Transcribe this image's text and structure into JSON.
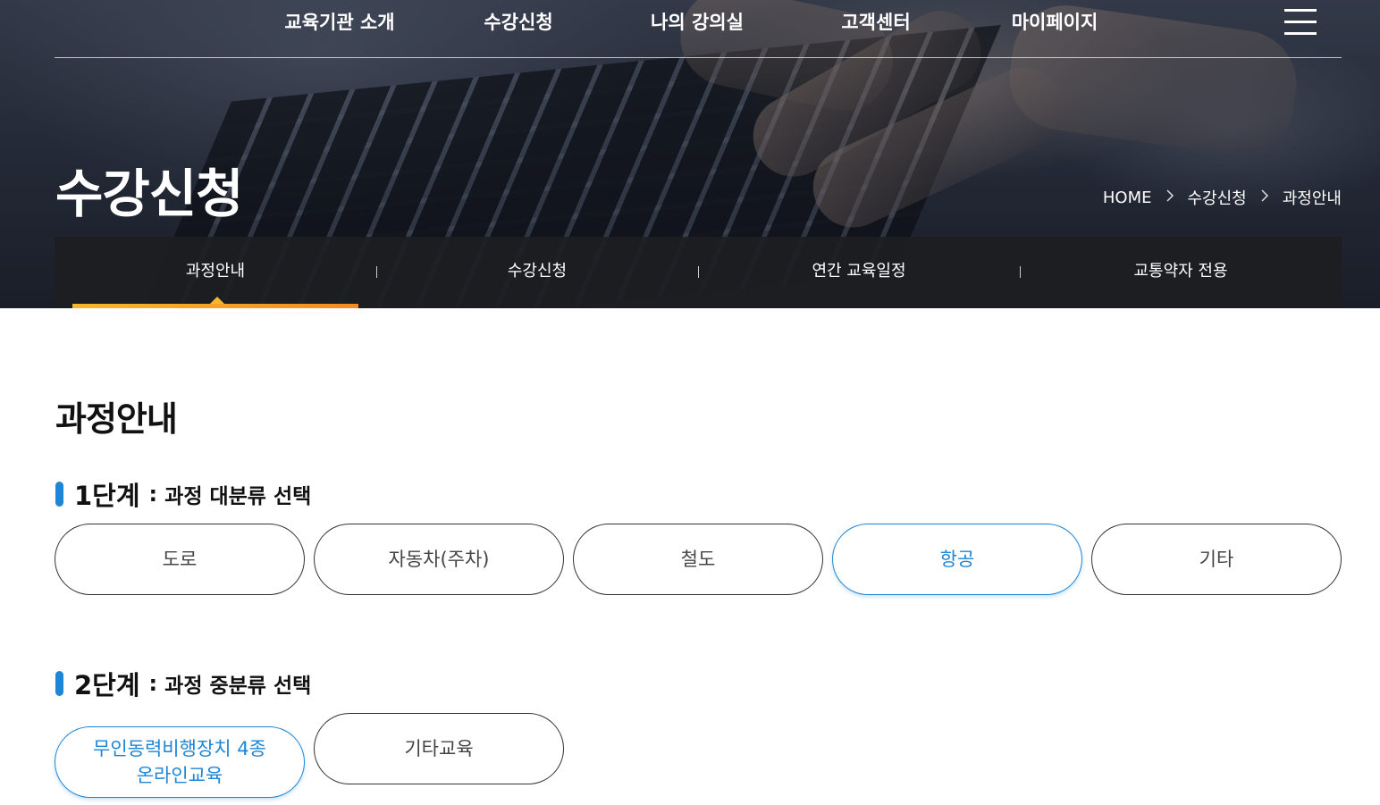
{
  "topnav": {
    "items": [
      "교육기관 소개",
      "수강신청",
      "나의 강의실",
      "고객센터",
      "마이페이지"
    ]
  },
  "hero": {
    "title": "수강신청",
    "breadcrumb": [
      "HOME",
      "수강신청",
      "과정안내"
    ],
    "breadcrumb_separator": ">"
  },
  "subtabs": {
    "items": [
      "과정안내",
      "수강신청",
      "연간 교육일정",
      "교통약자 전용"
    ],
    "active_index": 0
  },
  "main": {
    "title": "과정안내",
    "step1": {
      "number": "1단계",
      "colon": ":",
      "desc": "과정 대분류 선택",
      "options": [
        "도로",
        "자동차(주차)",
        "철도",
        "항공",
        "기타"
      ],
      "active_index": 3
    },
    "step2": {
      "number": "2단계",
      "colon": ":",
      "desc": "과정 중분류 선택",
      "options": [
        {
          "line1": "무인동력비행장치 4종",
          "line2": "온라인교육"
        },
        {
          "line1": "기타교육",
          "line2": ""
        }
      ],
      "active_index": 0
    }
  },
  "colors": {
    "accent_blue": "#1e86d4",
    "tab_active_gradient_start": "#f7b72a",
    "tab_active_gradient_end": "#f38b22"
  }
}
